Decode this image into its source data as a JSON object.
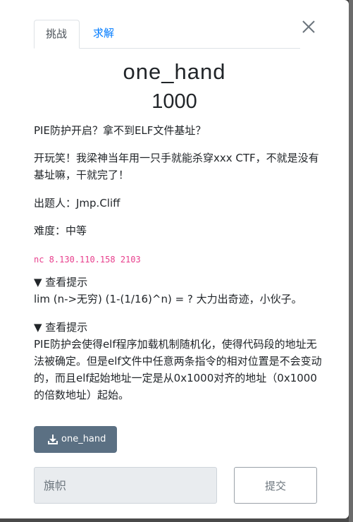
{
  "tabs": [
    {
      "label": "挑战",
      "active": true
    },
    {
      "label": "求解",
      "active": false
    }
  ],
  "challenge": {
    "name": "one_hand",
    "value": "1000",
    "description": [
      "PIE防护开启？拿不到ELF文件基址？",
      "开玩笑！我梁神当年用一只手就能杀穿xxx CTF，不就是没有基址嘛，干就完了！",
      "出题人：Jmp.Cliff",
      "难度：中等"
    ],
    "connection": "nc 8.130.110.158 2103"
  },
  "hints": [
    {
      "summary": "▼ 查看提示",
      "body": "lim (n->无穷) (1-(1/16)^n) = ? 大力出奇迹，小伙子。"
    },
    {
      "summary": "▼ 查看提示",
      "body": "PIE防护会使得elf程序加载机制随机化，使得代码段的地址无法被确定。但是elf文件中任意两条指令的相对位置是不会变动的，而且elf起始地址一定是从0x1000对齐的地址（0x1000的倍数地址）起始。"
    }
  ],
  "file_button": {
    "label": "one_hand",
    "icon": "download-icon"
  },
  "flag_input": {
    "placeholder": "旗帜",
    "value": ""
  },
  "submit_label": "提交",
  "icons": {
    "close": "close-icon"
  },
  "colors": {
    "tab_link": "#007bff",
    "code": "#e83e8c",
    "file_button_bg": "#5b7083"
  }
}
